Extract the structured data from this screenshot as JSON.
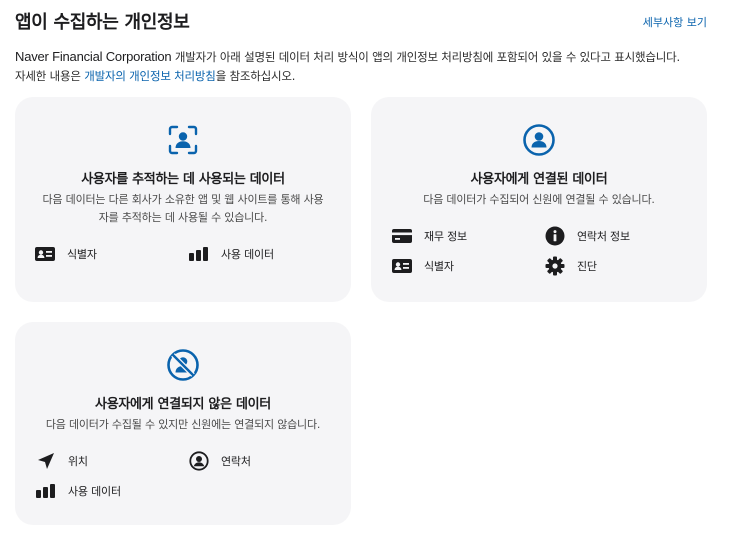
{
  "header": {
    "title": "앱이 수집하는 개인정보",
    "details_link": "세부사항 보기"
  },
  "description": {
    "company": "Naver Financial Corporation",
    "line1_rest": " 개발자가 아래 설명된 데이터 처리 방식이 앱의 개인정보 처리방침에 포함되어 있을 수 있다고 표시했습니다.",
    "line2_prefix": "자세한 내용은 ",
    "policy_link": "개발자의 개인정보 처리방침",
    "line2_suffix": "을 참조하십시오."
  },
  "cards": [
    {
      "icon": "tracking-icon",
      "title": "사용자를 추적하는 데 사용되는 데이터",
      "desc": "다음 데이터는 다른 회사가 소유한 앱 및 웹 사이트를 통해 사용자를 추적하는 데 사용될 수 있습니다.",
      "items": [
        {
          "icon": "id-card-icon",
          "label": "식별자"
        },
        {
          "icon": "bar-chart-icon",
          "label": "사용 데이터"
        }
      ]
    },
    {
      "icon": "user-circle-icon",
      "title": "사용자에게 연결된 데이터",
      "desc": "다음 데이터가 수집되어 신원에 연결될 수 있습니다.",
      "items": [
        {
          "icon": "credit-card-icon",
          "label": "재무 정보"
        },
        {
          "icon": "info-icon",
          "label": "연락처 정보"
        },
        {
          "icon": "id-card-icon",
          "label": "식별자"
        },
        {
          "icon": "gear-icon",
          "label": "진단"
        }
      ]
    },
    {
      "icon": "user-slash-icon",
      "title": "사용자에게 연결되지 않은 데이터",
      "desc": "다음 데이터가 수집될 수 있지만 신원에는 연결되지 않습니다.",
      "items": [
        {
          "icon": "location-arrow-icon",
          "label": "위치"
        },
        {
          "icon": "contact-icon",
          "label": "연락처"
        },
        {
          "icon": "bar-chart-icon",
          "label": "사용 데이터"
        }
      ]
    }
  ],
  "colors": {
    "accent": "#0a63ad",
    "card_bg": "#f5f5f7",
    "text": "#1d1d1f"
  }
}
